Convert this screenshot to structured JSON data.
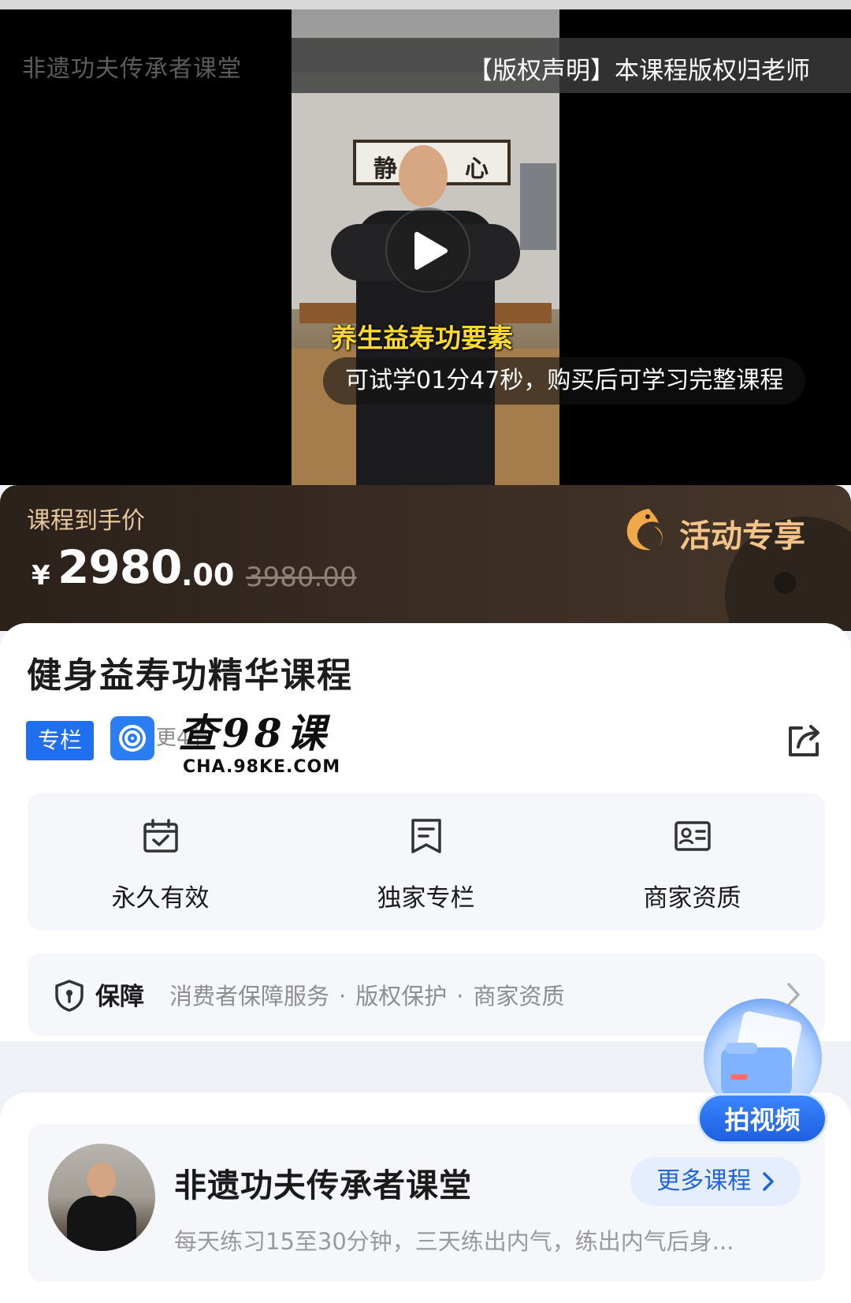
{
  "video": {
    "channel_watermark": "非遗功夫传承者课堂",
    "copyright_notice": "【版权声明】本课程版权归老师",
    "frame_calligraphy": [
      "静",
      "心"
    ],
    "subtitle": "养生益寿功要素",
    "trial_tip": "可试学01分47秒，购买后可学习完整课程",
    "play_icon": "play-icon"
  },
  "price": {
    "label": "课程到手价",
    "currency": "¥",
    "amount_int": "2980",
    "amount_dec": ".00",
    "original": "3980.00",
    "promo_label": "活动专享",
    "promo_color": "#f3c489"
  },
  "course": {
    "title": "健身益寿功精华课程",
    "tag": "专栏",
    "update_text": "更4节",
    "share_icon": "share-icon"
  },
  "watermark": {
    "big": "查98课",
    "small": "CHA.98KE.COM"
  },
  "features": [
    {
      "icon": "calendar-check-icon",
      "label": "永久有效"
    },
    {
      "icon": "bookmark-doc-icon",
      "label": "独家专栏"
    },
    {
      "icon": "id-card-icon",
      "label": "商家资质"
    }
  ],
  "guarantee": {
    "title": "保障",
    "items": [
      "消费者保障服务",
      "版权保护",
      "商家资质"
    ],
    "separator": "·"
  },
  "fab": {
    "label": "拍视频",
    "accent": "#1e5fe0"
  },
  "teacher": {
    "name": "非遗功夫传承者课堂",
    "more_label": "更多课程",
    "description": "每天练习15至30分钟，三天练出内气，练出内气后身..."
  }
}
